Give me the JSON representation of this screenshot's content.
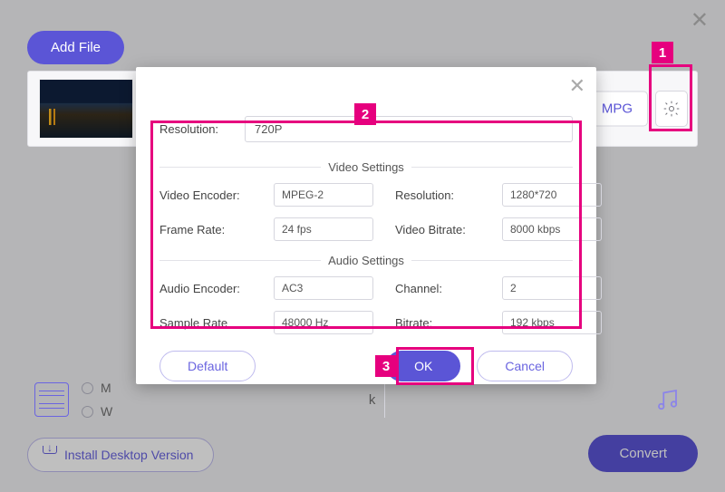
{
  "sidebar": {
    "add_file": "Add File"
  },
  "file_row": {
    "format_label": "MPG"
  },
  "radio_left": {
    "opt1": "M",
    "opt2": "W"
  },
  "k_label": "k",
  "install_label": "Install Desktop Version",
  "convert_label": "Convert",
  "modal": {
    "resolution_label": "Resolution:",
    "resolution_value": "720P",
    "video_settings_title": "Video Settings",
    "audio_settings_title": "Audio Settings",
    "labels": {
      "video_encoder": "Video Encoder:",
      "resolution": "Resolution:",
      "frame_rate": "Frame Rate:",
      "video_bitrate": "Video Bitrate:",
      "audio_encoder": "Audio Encoder:",
      "channel": "Channel:",
      "sample_rate": "Sample Rate",
      "bitrate": "Bitrate:"
    },
    "values": {
      "video_encoder": "MPEG-2",
      "resolution": "1280*720",
      "frame_rate": "24 fps",
      "video_bitrate": "8000 kbps",
      "audio_encoder": "AC3",
      "channel": "2",
      "sample_rate": "48000 Hz",
      "bitrate": "192 kbps"
    },
    "buttons": {
      "default": "Default",
      "ok": "OK",
      "cancel": "Cancel"
    }
  },
  "callouts": {
    "one": "1",
    "two": "2",
    "three": "3"
  }
}
